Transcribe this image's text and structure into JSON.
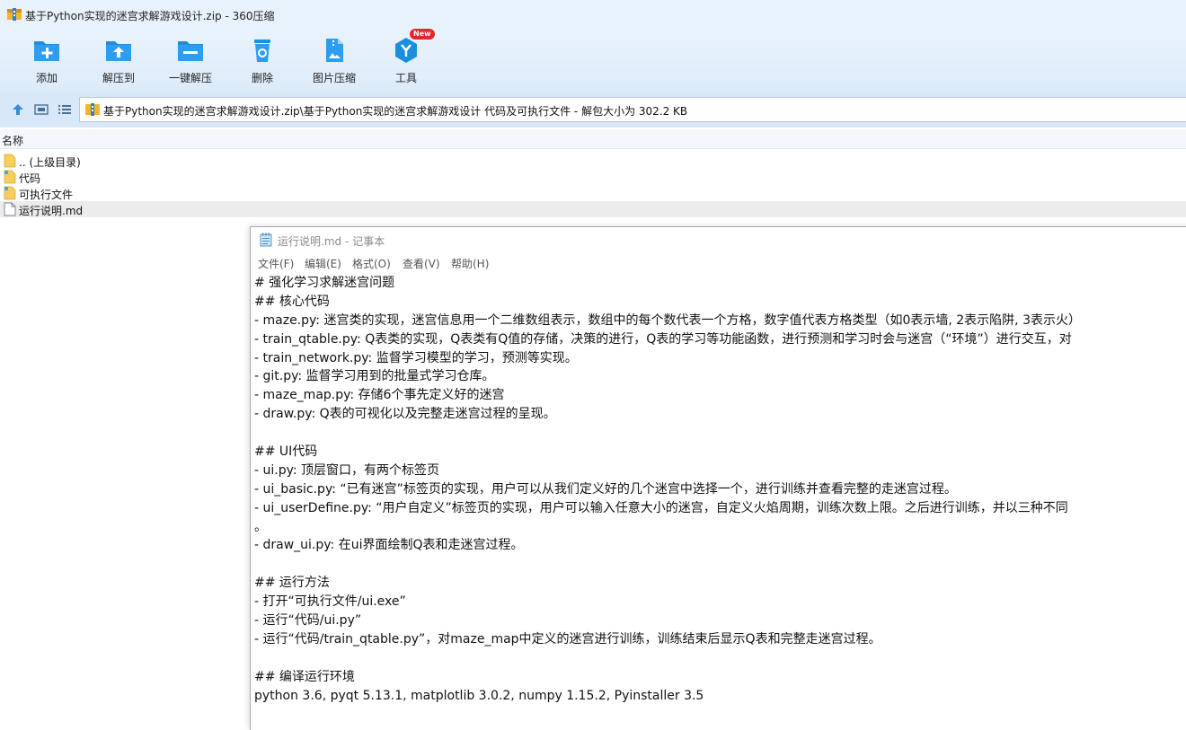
{
  "window": {
    "title": "基于Python实现的迷宫求解游戏设计.zip - 360压缩"
  },
  "toolbar": {
    "buttons": [
      {
        "label": "添加",
        "icon": "add-icon"
      },
      {
        "label": "解压到",
        "icon": "extract-to-icon"
      },
      {
        "label": "一键解压",
        "icon": "one-click-extract-icon"
      },
      {
        "label": "删除",
        "icon": "delete-icon"
      },
      {
        "label": "图片压缩",
        "icon": "image-compress-icon"
      },
      {
        "label": "工具",
        "icon": "tools-icon",
        "badge": "New"
      }
    ]
  },
  "address": {
    "path": "基于Python实现的迷宫求解游戏设计.zip\\基于Python实现的迷宫求解游戏设计 代码及可执行文件 - 解包大小为 302.2 KB"
  },
  "filelist": {
    "column_name": "名称",
    "items": [
      {
        "name": ".. (上级目录)",
        "type": "folder"
      },
      {
        "name": "代码",
        "type": "folder"
      },
      {
        "name": "可执行文件",
        "type": "folder"
      },
      {
        "name": "运行说明.md",
        "type": "file",
        "selected": true
      }
    ]
  },
  "notepad": {
    "title": "运行说明.md - 记事本",
    "menu": [
      "文件(F)",
      "编辑(E)",
      "格式(O)",
      "查看(V)",
      "帮助(H)"
    ],
    "lines": [
      "# 强化学习求解迷宫问题",
      "## 核心代码",
      "- maze.py: 迷宫类的实现，迷宫信息用一个二维数组表示，数组中的每个数代表一个方格，数字值代表方格类型（如0表示墙, 2表示陷阱, 3表示火）",
      "- train_qtable.py: Q表类的实现，Q表类有Q值的存储，决策的进行，Q表的学习等功能函数，进行预测和学习时会与迷宫（“环境”）进行交互，对",
      "- train_network.py: 监督学习模型的学习，预测等实现。",
      "- git.py: 监督学习用到的批量式学习仓库。",
      "- maze_map.py: 存储6个事先定义好的迷宫",
      "- draw.py: Q表的可视化以及完整走迷宫过程的呈现。",
      "",
      "## UI代码",
      "- ui.py: 顶层窗口，有两个标签页",
      "- ui_basic.py: “已有迷宫”标签页的实现，用户可以从我们定义好的几个迷宫中选择一个，进行训练并查看完整的走迷宫过程。",
      "- ui_userDefine.py: “用户自定义”标签页的实现，用户可以输入任意大小的迷宫，自定义火焰周期，训练次数上限。之后进行训练，并以三种不同",
      "。",
      "- draw_ui.py: 在ui界面绘制Q表和走迷宫过程。",
      "",
      "## 运行方法",
      "- 打开“可执行文件/ui.exe”",
      "- 运行“代码/ui.py”",
      "- 运行“代码/train_qtable.py”，对maze_map中定义的迷宫进行训练，训练结束后显示Q表和完整走迷宫过程。",
      "",
      "## 编译运行环境",
      "python 3.6, pyqt 5.13.1, matplotlib 3.0.2, numpy 1.15.2, Pyinstaller 3.5"
    ]
  },
  "colors": {
    "accent_blue": "#1a8fe0",
    "toolbar_bg": "#e4eefa",
    "badge_red": "#e8242c",
    "folder_yellow": "#f7cf5c"
  }
}
